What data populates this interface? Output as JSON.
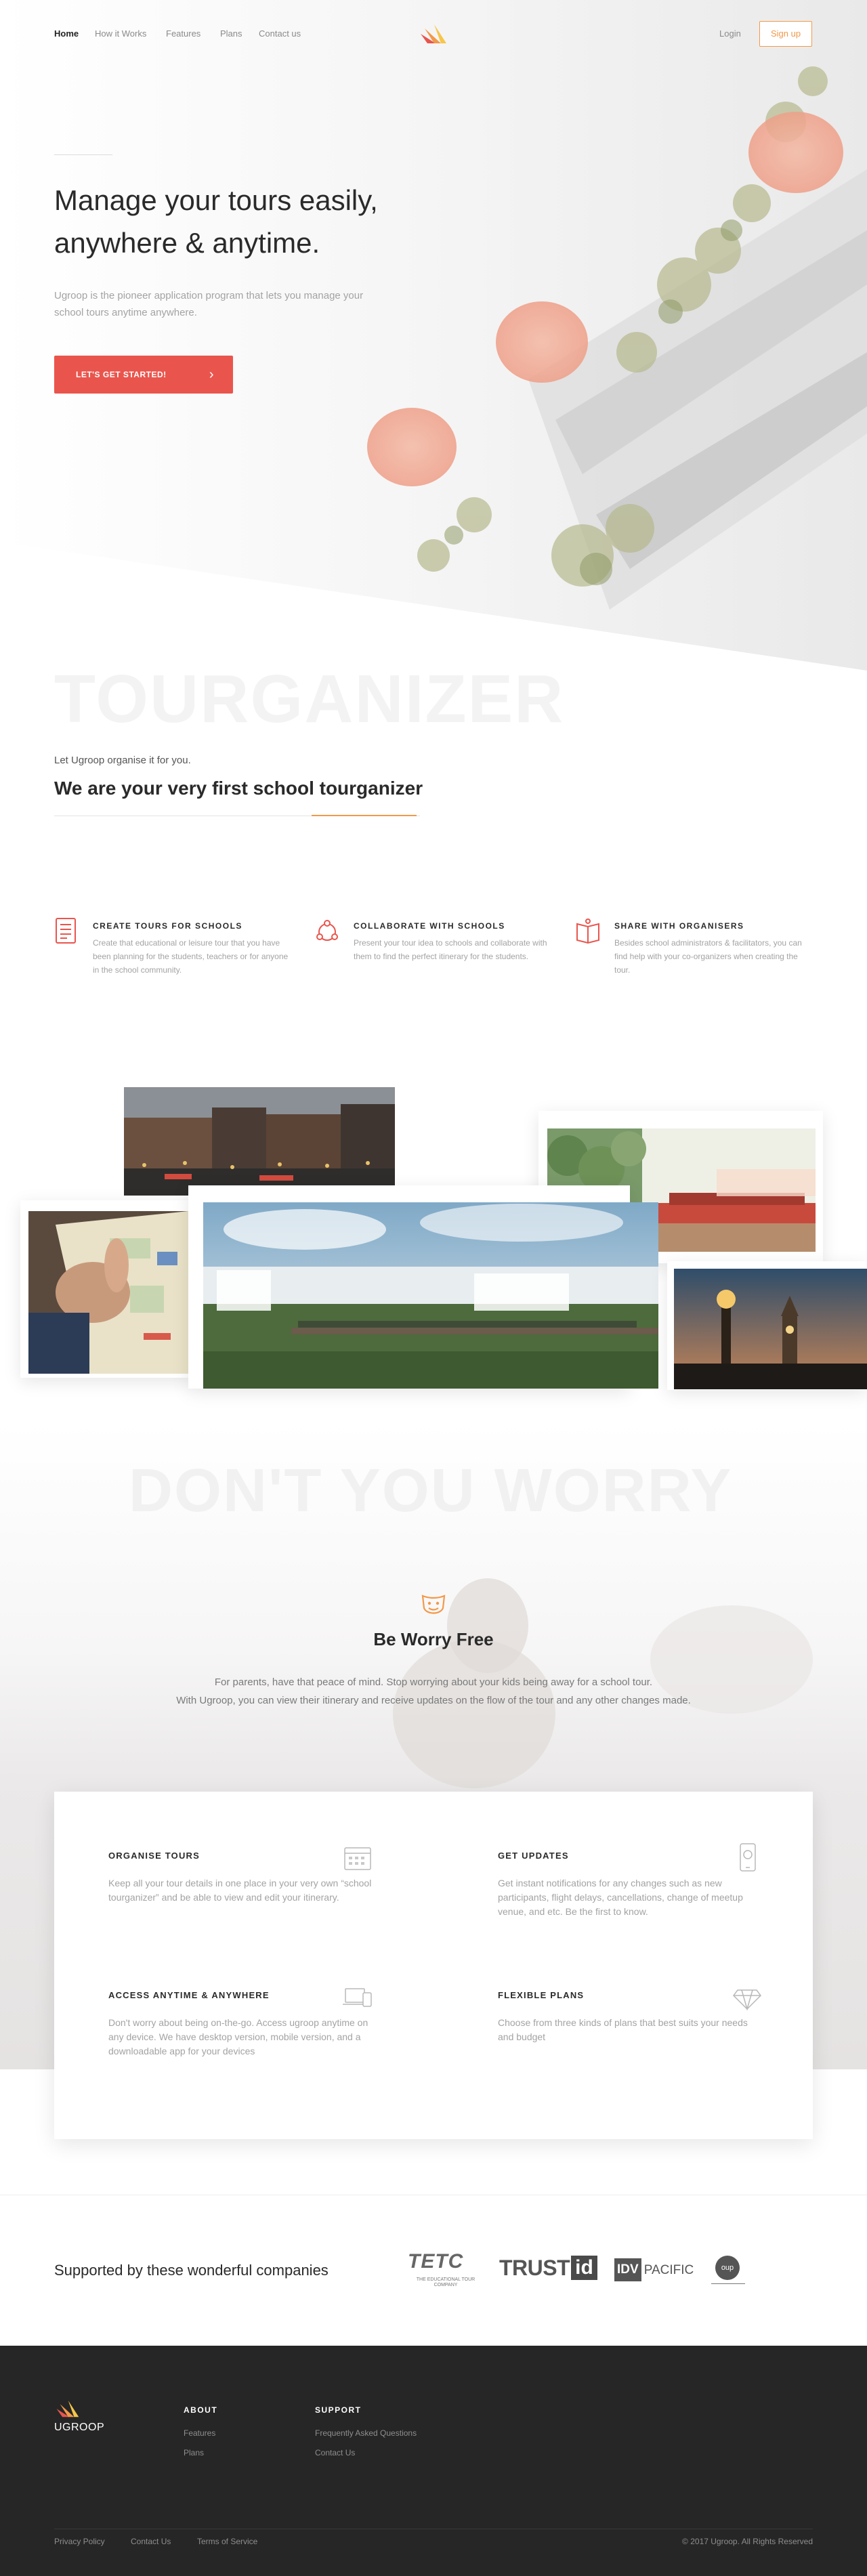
{
  "nav": {
    "items": [
      {
        "label": "Home"
      },
      {
        "label": "How it Works"
      },
      {
        "label": "Features"
      },
      {
        "label": "Plans"
      },
      {
        "label": "Contact us"
      }
    ],
    "login": "Login",
    "signup": "Sign up"
  },
  "hero": {
    "title_line1": "Manage your tours easily,",
    "title_line2": "anywhere & anytime.",
    "subtitle": "Ugroop is the pioneer application program that lets you manage your school tours anytime anywhere.",
    "cta": "LET'S GET STARTED!"
  },
  "intro": {
    "watermark": "TOURGANIZER",
    "eyebrow": "Let Ugroop organise it for you.",
    "title": "We are your very first school tourganizer"
  },
  "features": [
    {
      "icon": "document-list-icon",
      "title": "CREATE TOURS FOR SCHOOLS",
      "text": "Create that educational or leisure tour that you have been planning for the students, teachers or for anyone in the school community."
    },
    {
      "icon": "collaborate-icon",
      "title": "COLLABORATE WITH SCHOOLS",
      "text": "Present your tour idea to schools and collaborate with them to find the perfect itinerary for the students."
    },
    {
      "icon": "open-book-icon",
      "title": "SHARE WITH ORGANISERS",
      "text": "Besides school administrators & facilitators, you can find help with your co-organizers when creating the tour."
    }
  ],
  "worry": {
    "watermark": "DON'T YOU WORRY",
    "title": "Be Worry Free",
    "text_line1": "For parents, have that peace of mind. Stop worrying about your kids being away for a school tour.",
    "text_line2": "With Ugroop, you can view their itinerary and receive updates on the flow of the tour and any other changes made."
  },
  "benefits": [
    {
      "icon": "calendar-icon",
      "title": "ORGANISE TOURS",
      "text": "Keep all your tour details in one place in your very own “school tourganizer” and be able to view and edit your itinerary."
    },
    {
      "icon": "phone-notification-icon",
      "title": "GET UPDATES",
      "text": "Get instant notifications for any changes such as new participants, flight delays, cancellations, change of meetup venue, and etc. Be the first to know."
    },
    {
      "icon": "devices-icon",
      "title": "ACCESS ANYTIME & ANYWHERE",
      "text": "Don't worry about being on-the-go. Access ugroop anytime on any device. We have desktop version, mobile version, and a downloadable app for your devices"
    },
    {
      "icon": "diamond-icon",
      "title": "FLEXIBLE PLANS",
      "text": "Choose from three kinds of plans that best suits your needs and budget"
    }
  ],
  "supporters": {
    "title": "Supported by these wonderful companies",
    "partners": [
      {
        "name": "TETC",
        "tagline": "THE EDUCATIONAL TOUR COMPANY"
      },
      {
        "name": "TRUST",
        "mark": "id"
      },
      {
        "name": "IDV",
        "suffix": "PACIFIC"
      },
      {
        "name": "oup"
      }
    ]
  },
  "footer": {
    "brand": "UGROOP",
    "about_title": "ABOUT",
    "about_links": [
      "Features",
      "Plans"
    ],
    "support_title": "SUPPORT",
    "support_links": [
      "Frequently Asked Questions",
      "Contact Us"
    ],
    "bottom_links": [
      "Privacy Policy",
      "Contact Us",
      "Terms of Service"
    ],
    "copyright": "© 2017 Ugroop. All Rights Reserved"
  },
  "colors": {
    "accent_orange": "#f2994a",
    "cta_red": "#e9554d",
    "footer_bg": "#262626"
  }
}
